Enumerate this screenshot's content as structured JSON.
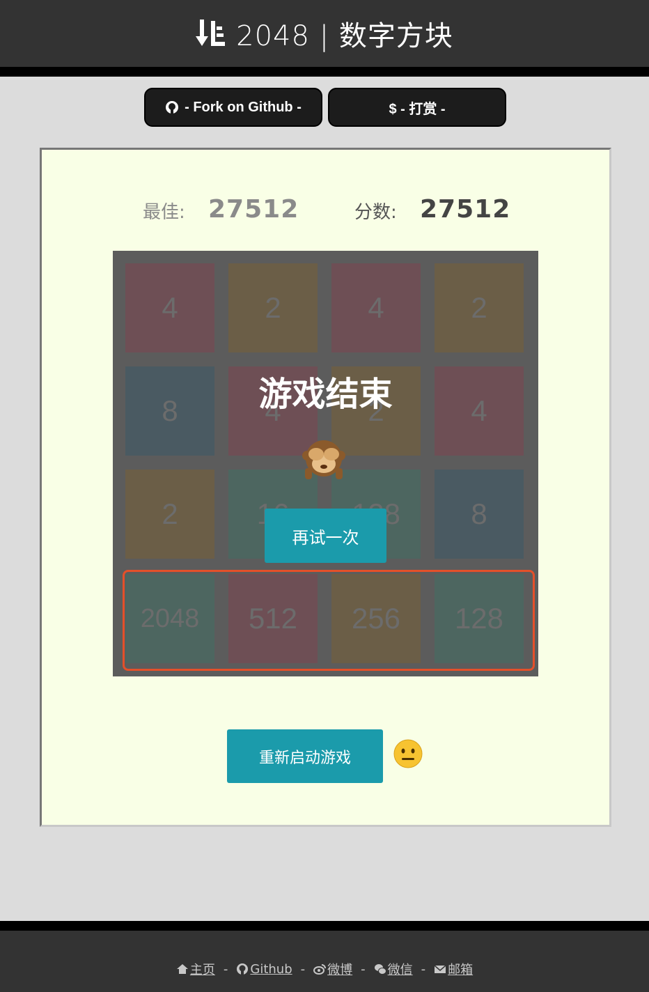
{
  "header": {
    "title": "2048 | 数字方块",
    "icon": "sort-down-icon"
  },
  "top_buttons": {
    "fork_label": "- Fork on Github -",
    "donate_label": "$ - 打赏 -"
  },
  "scores": {
    "best_label": "最佳:",
    "best_value": "27512",
    "current_label": "分数:",
    "current_value": "27512"
  },
  "board": {
    "rows": [
      [
        {
          "v": "4",
          "c": "#6e4f55"
        },
        {
          "v": "2",
          "c": "#6b5e47"
        },
        {
          "v": "4",
          "c": "#6e4f55"
        },
        {
          "v": "2",
          "c": "#6b5e47"
        }
      ],
      [
        {
          "v": "8",
          "c": "#4a5a62"
        },
        {
          "v": "4",
          "c": "#6e4f55"
        },
        {
          "v": "2",
          "c": "#6b5e47"
        },
        {
          "v": "4",
          "c": "#6e4f55"
        }
      ],
      [
        {
          "v": "2",
          "c": "#6b5e47"
        },
        {
          "v": "16",
          "c": "#4d6660"
        },
        {
          "v": "128",
          "c": "#4d6660"
        },
        {
          "v": "8",
          "c": "#4a5a62"
        }
      ],
      [
        {
          "v": "2048",
          "c": "#4d6660"
        },
        {
          "v": "512",
          "c": "#6e4f55"
        },
        {
          "v": "256",
          "c": "#6b5e47"
        },
        {
          "v": "128",
          "c": "#4d6660"
        }
      ]
    ]
  },
  "overlay": {
    "title": "游戏结束",
    "retry_label": "再试一次",
    "emoji": "see-no-evil-monkey-icon"
  },
  "restart": {
    "label": "重新启动游戏",
    "emoji": "neutral-face-icon"
  },
  "footer": {
    "links": [
      {
        "label": "主页",
        "icon": "home-icon"
      },
      {
        "label": "Github",
        "icon": "github-icon"
      },
      {
        "label": "微博",
        "icon": "weibo-icon"
      },
      {
        "label": "微信",
        "icon": "wechat-icon"
      },
      {
        "label": "邮箱",
        "icon": "envelope-icon"
      }
    ],
    "separator": "-"
  }
}
